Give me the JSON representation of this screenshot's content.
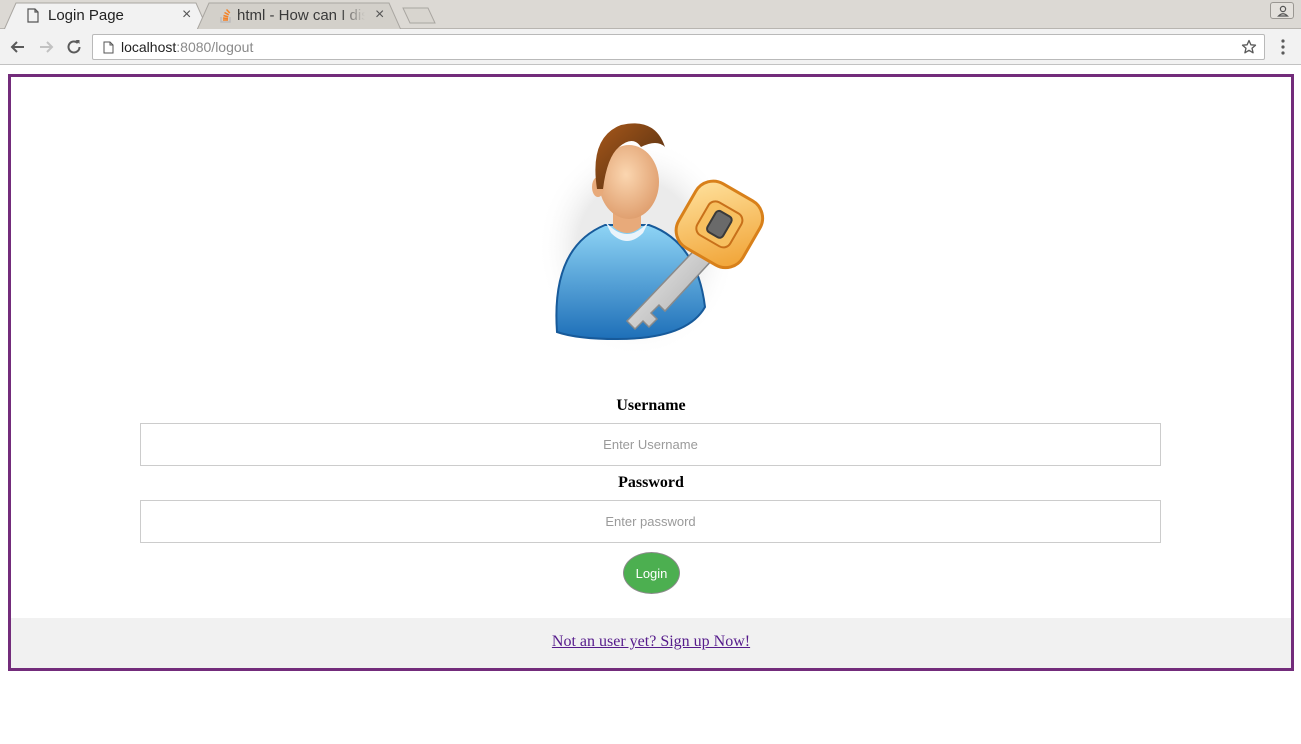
{
  "browser": {
    "tabs": [
      {
        "title": "Login Page",
        "active": true,
        "favicon": "page-icon"
      },
      {
        "title": "html - How can I dis",
        "active": false,
        "favicon": "stackoverflow-icon"
      }
    ],
    "close_glyph": "×",
    "address": {
      "host": "localhost",
      "path": ":8080/logout"
    }
  },
  "login": {
    "avatar": "user-with-key-icon",
    "username_label": "Username",
    "username_placeholder": "Enter Username",
    "password_label": "Password",
    "password_placeholder": "Enter password",
    "login_button": "Login",
    "signup_link": "Not an user yet? Sign up Now!"
  },
  "colors": {
    "frame_border": "#732c7b",
    "login_button": "#4caf50",
    "footer_background": "#f1f1f1",
    "link_visited": "#551a8b"
  }
}
